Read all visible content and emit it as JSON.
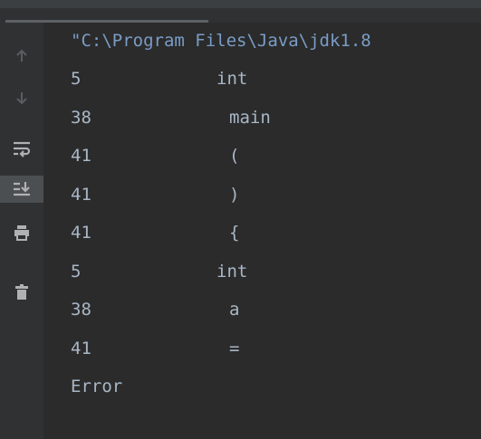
{
  "console": {
    "command": "\"C:\\Program Files\\Java\\jdk1.8",
    "rows": [
      {
        "code": "5",
        "token": "int",
        "indent": 0
      },
      {
        "code": "38",
        "token": "main",
        "indent": 1
      },
      {
        "code": "41",
        "token": "(",
        "indent": 1
      },
      {
        "code": "41",
        "token": ")",
        "indent": 1
      },
      {
        "code": "41",
        "token": "{",
        "indent": 1
      },
      {
        "code": "5",
        "token": "int",
        "indent": 0
      },
      {
        "code": "38",
        "token": "a",
        "indent": 1
      },
      {
        "code": "41",
        "token": "=",
        "indent": 1
      }
    ],
    "error": "Error"
  },
  "toolbar": {
    "icons": [
      "up-arrow-icon",
      "down-arrow-icon",
      "soft-wrap-icon",
      "scroll-to-end-icon",
      "print-icon",
      "trash-icon"
    ]
  },
  "colors": {
    "background": "#2b2b2b",
    "gutter": "#2f3133",
    "text": "#a9b7c6",
    "command": "#7a9cc6"
  }
}
